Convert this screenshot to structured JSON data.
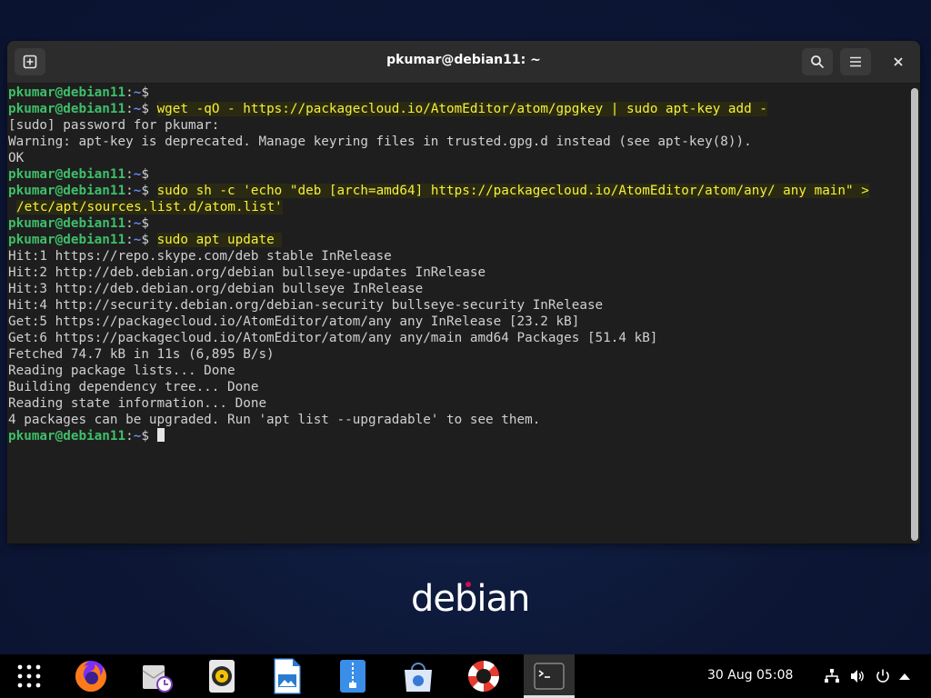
{
  "window": {
    "title": "pkumar@debian11: ~"
  },
  "prompt": {
    "user_host": "pkumar@debian11",
    "colon": ":",
    "path": "~",
    "symbol": "$"
  },
  "terminal_lines": [
    {
      "type": "prompt",
      "cmd": ""
    },
    {
      "type": "prompt",
      "cmd": "wget -qO - https://packagecloud.io/AtomEditor/atom/gpgkey | sudo apt-key add -"
    },
    {
      "type": "out",
      "text": "[sudo] password for pkumar:"
    },
    {
      "type": "out",
      "text": "Warning: apt-key is deprecated. Manage keyring files in trusted.gpg.d instead (see apt-key(8))."
    },
    {
      "type": "out",
      "text": "OK"
    },
    {
      "type": "prompt",
      "cmd": ""
    },
    {
      "type": "prompt",
      "cmd": "sudo sh -c 'echo \"deb [arch=amd64] https://packagecloud.io/AtomEditor/atom/any/ any main\" >"
    },
    {
      "type": "cont",
      "text": "/etc/apt/sources.list.d/atom.list'"
    },
    {
      "type": "prompt",
      "cmd": ""
    },
    {
      "type": "prompt",
      "cmd": "sudo apt update "
    },
    {
      "type": "out",
      "text": "Hit:1 https://repo.skype.com/deb stable InRelease"
    },
    {
      "type": "out",
      "text": "Hit:2 http://deb.debian.org/debian bullseye-updates InRelease"
    },
    {
      "type": "out",
      "text": "Hit:3 http://deb.debian.org/debian bullseye InRelease"
    },
    {
      "type": "out",
      "text": "Hit:4 http://security.debian.org/debian-security bullseye-security InRelease"
    },
    {
      "type": "out",
      "text": "Get:5 https://packagecloud.io/AtomEditor/atom/any any InRelease [23.2 kB]"
    },
    {
      "type": "out",
      "text": "Get:6 https://packagecloud.io/AtomEditor/atom/any any/main amd64 Packages [51.4 kB]"
    },
    {
      "type": "out",
      "text": "Fetched 74.7 kB in 11s (6,895 B/s)"
    },
    {
      "type": "out",
      "text": "Reading package lists... Done"
    },
    {
      "type": "out",
      "text": "Building dependency tree... Done"
    },
    {
      "type": "out",
      "text": "Reading state information... Done"
    },
    {
      "type": "out",
      "text": "4 packages can be upgraded. Run 'apt list --upgradable' to see them."
    },
    {
      "type": "prompt",
      "cmd": "",
      "cursor": true
    }
  ],
  "desktop": {
    "logo_text": "debian"
  },
  "taskbar": {
    "apps": [
      "app-grid-icon",
      "firefox-icon",
      "mail-clock-icon",
      "rhythmbox-icon",
      "libreoffice-impress-icon",
      "file-archive-icon",
      "software-store-icon",
      "help-lifebuoy-icon",
      "terminal-icon"
    ],
    "clock": "30 Aug  05:08",
    "tray": [
      "network-icon",
      "volume-icon",
      "power-icon",
      "arrow-up-icon"
    ]
  },
  "colors": {
    "prompt_user": "#3fbf6a",
    "prompt_path": "#5a8cf0",
    "highlight": "#f5f03a",
    "terminal_bg": "#1e1e1e"
  }
}
